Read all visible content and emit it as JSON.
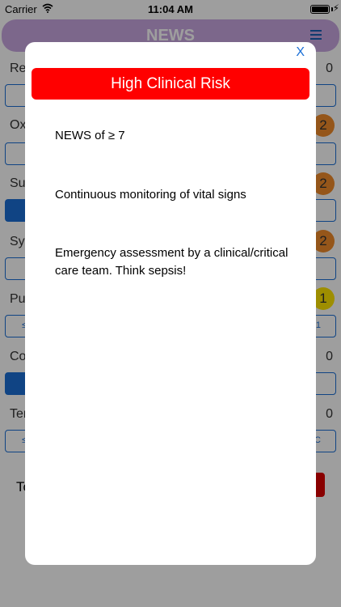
{
  "status_bar": {
    "carrier": "Carrier",
    "time": "11:04 AM"
  },
  "app": {
    "title": "NEWS",
    "rows": [
      {
        "label": "Res",
        "score": "0"
      },
      {
        "label": "Oxy",
        "score": "2"
      },
      {
        "label": "Sup",
        "score": "2"
      },
      {
        "label": "Sys",
        "score": "2"
      },
      {
        "label": "Pul",
        "score": "1"
      },
      {
        "label": "Con",
        "score": "0"
      },
      {
        "label": "Ten",
        "score": "0"
      }
    ],
    "segment_texts": {
      "pulse_left": "≤",
      "pulse_right": "1",
      "temp_left": "≤",
      "temp_right": "C"
    },
    "total_label": "To",
    "colors": {
      "header": "#c8a7e0",
      "accent": "#1a6fd6",
      "orange": "#f08c2a",
      "yellow": "#ffe600",
      "red": "#ff0000"
    }
  },
  "modal": {
    "close_label": "X",
    "risk_title": "High Clinical Risk",
    "messages": [
      "NEWS of ≥ 7",
      "Continuous monitoring of vital signs",
      "Emergency assessment by a clinical/critical care team. Think sepsis!"
    ]
  }
}
